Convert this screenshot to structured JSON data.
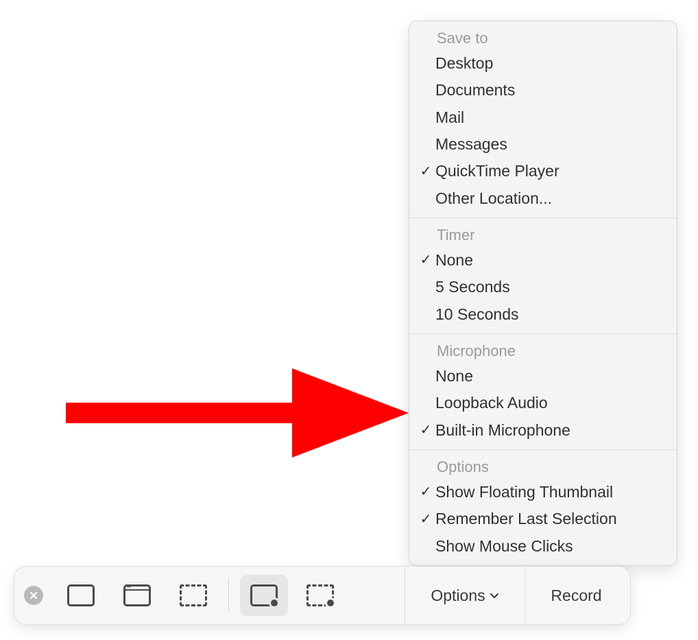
{
  "menu": {
    "sections": [
      {
        "header": "Save to",
        "items": [
          {
            "label": "Desktop",
            "checked": false
          },
          {
            "label": "Documents",
            "checked": false
          },
          {
            "label": "Mail",
            "checked": false
          },
          {
            "label": "Messages",
            "checked": false
          },
          {
            "label": "QuickTime Player",
            "checked": true
          },
          {
            "label": "Other Location...",
            "checked": false
          }
        ]
      },
      {
        "header": "Timer",
        "items": [
          {
            "label": "None",
            "checked": true
          },
          {
            "label": "5 Seconds",
            "checked": false
          },
          {
            "label": "10 Seconds",
            "checked": false
          }
        ]
      },
      {
        "header": "Microphone",
        "items": [
          {
            "label": "None",
            "checked": false
          },
          {
            "label": "Loopback Audio",
            "checked": false
          },
          {
            "label": "Built-in Microphone",
            "checked": true
          }
        ]
      },
      {
        "header": "Options",
        "items": [
          {
            "label": "Show Floating Thumbnail",
            "checked": true
          },
          {
            "label": "Remember Last Selection",
            "checked": true
          },
          {
            "label": "Show Mouse Clicks",
            "checked": false
          }
        ]
      }
    ]
  },
  "toolbar": {
    "options_label": "Options",
    "record_label": "Record"
  },
  "annotation": {
    "arrow_color": "#ff0000"
  }
}
